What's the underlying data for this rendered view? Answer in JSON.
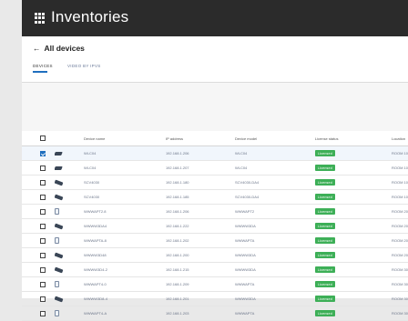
{
  "app": {
    "title": "Inventories"
  },
  "nav": {
    "back_label": "All devices"
  },
  "tabs": [
    {
      "label": "DEVICES",
      "active": true
    },
    {
      "label": "VIDEO BY IPVS",
      "active": false
    }
  ],
  "table": {
    "headers": [
      "Device name",
      "IP address",
      "Device model",
      "License status",
      "Location"
    ],
    "rows": [
      {
        "type": "router",
        "checked": true,
        "name": "WLC04",
        "ip": "192.168.1.206",
        "model": "WLC04",
        "license": "Licensed",
        "location": "ROOM 10"
      },
      {
        "type": "router",
        "checked": false,
        "name": "WLC04",
        "ip": "192.168.1.207",
        "model": "WLC04",
        "license": "Licensed",
        "location": "ROOM 10"
      },
      {
        "type": "switch",
        "checked": false,
        "name": "SCV4030",
        "ip": "192.168.1.180",
        "model": "SCV4030-DA4",
        "license": "Licensed",
        "location": "ROOM 10"
      },
      {
        "type": "switch",
        "checked": false,
        "name": "SCV4030",
        "ip": "192.168.1.185",
        "model": "SCV4030-DA4",
        "license": "Licensed",
        "location": "ROOM 10"
      },
      {
        "type": "ap",
        "checked": false,
        "name": "WWWAPT2.8",
        "ip": "192.168.1.206",
        "model": "WWWAPT2",
        "license": "Licensed",
        "location": "ROOM 20"
      },
      {
        "type": "switch",
        "checked": false,
        "name": "WWWW3DA4",
        "ip": "192.168.1.222",
        "model": "WWWW3DA",
        "license": "Licensed",
        "location": "ROOM 20"
      },
      {
        "type": "ap",
        "checked": false,
        "name": "WWWAPTA-8",
        "ip": "192.168.1.202",
        "model": "WWWAPTA",
        "license": "Licensed",
        "location": "ROOM 20"
      },
      {
        "type": "switch",
        "checked": false,
        "name": "WWWW3D48",
        "ip": "192.168.1.200",
        "model": "WWWW3DA",
        "license": "Licensed",
        "location": "ROOM 20"
      },
      {
        "type": "switch",
        "checked": false,
        "name": "WWWW3D4-2",
        "ip": "192.168.1.215",
        "model": "WWWW3DA",
        "license": "Licensed",
        "location": "ROOM 30"
      },
      {
        "type": "ap",
        "checked": false,
        "name": "WWWAPT4-0",
        "ip": "192.168.1.209",
        "model": "WWWAPTA",
        "license": "Licensed",
        "location": "ROOM 30"
      },
      {
        "type": "switch",
        "checked": false,
        "name": "WWWW3D8-4",
        "ip": "192.168.1.201",
        "model": "WWWW3DA",
        "license": "Licensed",
        "location": "ROOM 30"
      },
      {
        "type": "ap",
        "checked": false,
        "name": "WWWAPT4-A",
        "ip": "192.168.1.203",
        "model": "WWWAPTA",
        "license": "Licensed",
        "location": "ROOM 30"
      }
    ]
  },
  "colors": {
    "appbar": "#2b2b2b",
    "accent": "#1f6fbf",
    "licensed": "#3daf57"
  }
}
